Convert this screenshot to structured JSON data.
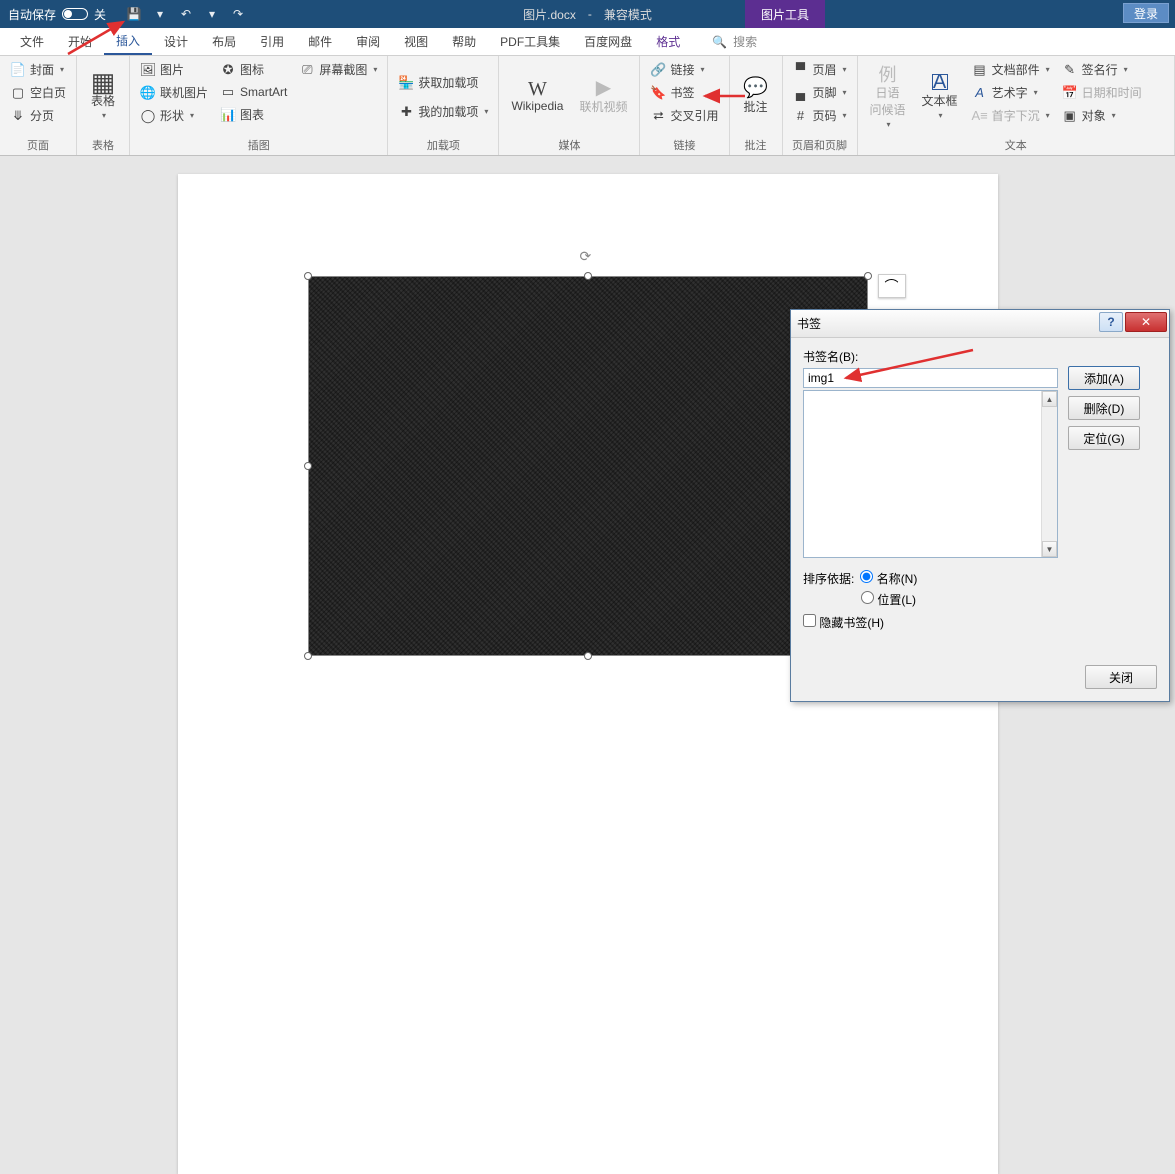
{
  "titlebar": {
    "autosave_label": "自动保存",
    "autosave_state": "关",
    "doc_name": "图片.docx",
    "compat_mode": "兼容模式",
    "context_tool": "图片工具",
    "login": "登录"
  },
  "tabs": {
    "file": "文件",
    "home": "开始",
    "insert": "插入",
    "design": "设计",
    "layout": "布局",
    "references": "引用",
    "mailings": "邮件",
    "review": "审阅",
    "view": "视图",
    "help": "帮助",
    "pdf": "PDF工具集",
    "baidu": "百度网盘",
    "format": "格式",
    "search_placeholder": "搜索"
  },
  "ribbon": {
    "pages": {
      "cover": "封面",
      "blank": "空白页",
      "page_break": "分页",
      "group": "页面"
    },
    "tables": {
      "table": "表格",
      "group": "表格"
    },
    "illustrations": {
      "pictures": "图片",
      "online_pictures": "联机图片",
      "shapes": "形状",
      "icons": "图标",
      "smartart": "SmartArt",
      "chart": "图表",
      "screenshot": "屏幕截图",
      "group": "插图"
    },
    "addins": {
      "get": "获取加载项",
      "my": "我的加载项",
      "group": "加载项"
    },
    "media": {
      "wikipedia": "Wikipedia",
      "online_video": "联机视频",
      "group": "媒体"
    },
    "links": {
      "link": "链接",
      "bookmark": "书签",
      "cross_ref": "交叉引用",
      "group": "链接"
    },
    "comments": {
      "comment": "批注",
      "group": "批注"
    },
    "header_footer": {
      "header": "页眉",
      "footer": "页脚",
      "page_number": "页码",
      "group": "页眉和页脚"
    },
    "text": {
      "greeting": "日语\n问候语",
      "textbox": "文本框",
      "quick_parts": "文档部件",
      "wordart": "艺术字",
      "drop_cap": "首字下沉",
      "signature": "签名行",
      "datetime": "日期和时间",
      "object": "对象",
      "group": "文本"
    }
  },
  "dialog": {
    "title": "书签",
    "name_label": "书签名(B):",
    "name_value": "img1",
    "add": "添加(A)",
    "delete": "删除(D)",
    "goto": "定位(G)",
    "sort_label": "排序依据:",
    "sort_name": "名称(N)",
    "sort_location": "位置(L)",
    "hidden": "隐藏书签(H)",
    "close": "关闭"
  }
}
